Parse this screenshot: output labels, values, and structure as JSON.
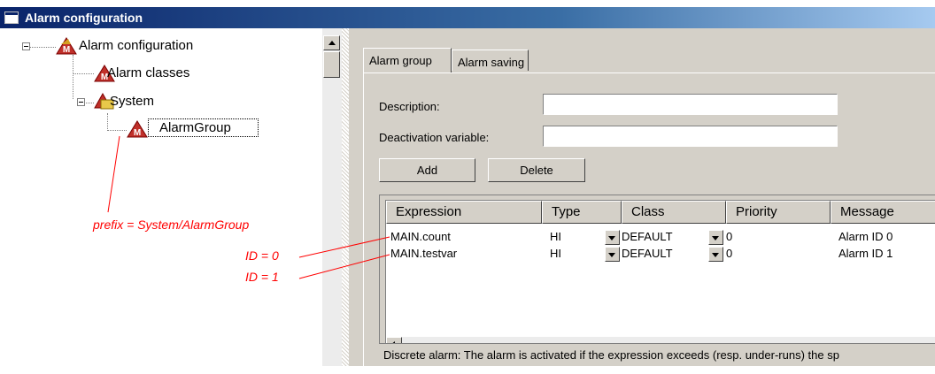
{
  "window": {
    "title": "Alarm configuration"
  },
  "tree": {
    "nodes": [
      {
        "label": "Alarm configuration",
        "icon": "alarm-config-icon"
      },
      {
        "label": "Alarm classes",
        "icon": "alarm-classes-icon"
      },
      {
        "label": "System",
        "icon": "folder-icon"
      },
      {
        "label": "AlarmGroup",
        "icon": "alarm-group-icon"
      }
    ]
  },
  "tabs": [
    {
      "label": "Alarm group",
      "active": true
    },
    {
      "label": "Alarm saving",
      "active": false
    }
  ],
  "form": {
    "description_label": "Description:",
    "description_value": "",
    "deactivation_label": "Deactivation variable:",
    "deactivation_value": ""
  },
  "buttons": {
    "add": "Add",
    "delete": "Delete"
  },
  "table": {
    "columns": [
      "Expression",
      "Type",
      "Class",
      "Priority",
      "Message"
    ],
    "rows": [
      {
        "expression": "MAIN.count",
        "type": "HI",
        "class": "DEFAULT",
        "priority": "0",
        "message": "Alarm ID 0"
      },
      {
        "expression": "MAIN.testvar",
        "type": "HI",
        "class": "DEFAULT",
        "priority": "0",
        "message": "Alarm ID 1"
      }
    ]
  },
  "status": {
    "text": "Discrete alarm: The alarm is activated if the expression exceeds (resp. under-runs) the sp"
  },
  "annotations": {
    "prefix": "prefix = System/AlarmGroup",
    "id0": "ID = 0",
    "id1": "ID = 1",
    "color": "#ff0000"
  },
  "colors": {
    "title_bar": "#0a246a",
    "panel": "#d4d0c8",
    "alarm_icon": "#c0302a"
  }
}
